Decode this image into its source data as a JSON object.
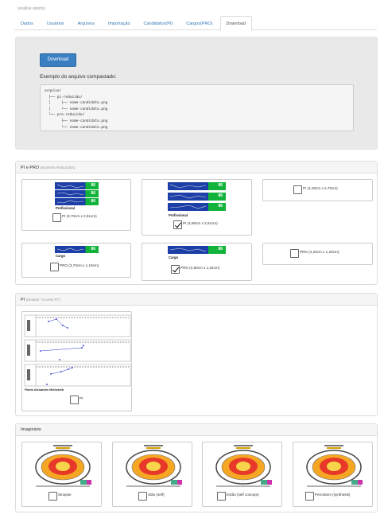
{
  "status": "(análise aberta)",
  "tabs": [
    {
      "label": "Dados"
    },
    {
      "label": "Usuários"
    },
    {
      "label": "Arquivos"
    },
    {
      "label": "Importação"
    },
    {
      "label": "Candidatos(PI)"
    },
    {
      "label": "Cargos(PRO)"
    },
    {
      "label": "Download"
    }
  ],
  "active_tab": "Download",
  "download": {
    "button_label": "Download",
    "example_title": "Exemplo do arquivo compactado:",
    "tree": [
      "arquivo/",
      "  ├── pi-reduzido/",
      "  │     ├── nome-candidato.png",
      "  │     └── nome-candidato.png",
      "  └── pro-reduzido/",
      "        ├── nome-candidato.png",
      "        └── nome-candidato.png"
    ]
  },
  "pi_pro": {
    "title": "PI e PRO",
    "subtitle": "(Modelos Reduzidos)",
    "cards": [
      {
        "label": "PI  (3,70cm x 2,51cm)",
        "checked": false,
        "thumb_caption": "Profissional",
        "strip_values": [
          "86",
          "86",
          "86"
        ]
      },
      {
        "label": "PI  (4,90cm x 2,91cm)",
        "checked": true,
        "thumb_caption": "Profissional",
        "strip_values": [
          "86",
          "86",
          "86"
        ]
      },
      {
        "label": "PI  (4,20cm x 2,70cm)",
        "checked": false
      },
      {
        "label": "PRO (3,70cm x 1,19cm)",
        "checked": false,
        "thumb_caption": "Cargo",
        "strip_values": [
          "86"
        ]
      },
      {
        "label": "PRO (4,90cm x 1,32cm)",
        "checked": true,
        "thumb_caption": "Cargo",
        "strip_values": [
          "86"
        ]
      },
      {
        "label": "PRO (4,20cm x 1,20cm)",
        "checked": false
      }
    ]
  },
  "pi_access": {
    "title": "PI",
    "subtitle": "(Modelo \"Access PI\")",
    "card_label": "PI",
    "checked": false,
    "chart_caption": "Flávio Alexandre Michelotti"
  },
  "imaginario": {
    "title": "Imaginário",
    "cards": [
      {
        "label": "Sinopse",
        "checked": false
      },
      {
        "label": "Sião (self)",
        "checked": false
      },
      {
        "label": "Estão (self concept)",
        "checked": false
      },
      {
        "label": "Percebem (synthesis)",
        "checked": false
      }
    ]
  },
  "colors": {
    "primary": "#3a7fc1",
    "link": "#337ab7",
    "strip_blue": "#1d3fa8",
    "strip_green": "#12b33a"
  }
}
